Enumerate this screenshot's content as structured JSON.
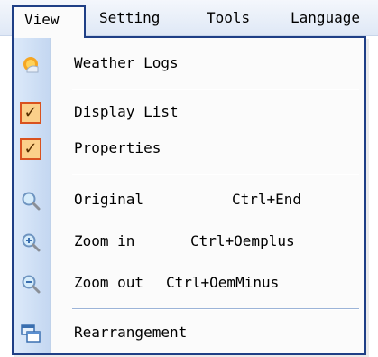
{
  "menubar": {
    "items": [
      "View",
      "Setting",
      "Tools",
      "Language"
    ],
    "active": "View"
  },
  "menu": {
    "weather_logs": "Weather Logs",
    "display_list": "Display List",
    "properties": "Properties",
    "original": "Original",
    "original_shortcut": "Ctrl+End",
    "zoom_in": "Zoom in",
    "zoom_in_shortcut": "Ctrl+Oemplus",
    "zoom_out": "Zoom out",
    "zoom_out_shortcut": "Ctrl+OemMinus",
    "rearrangement": "Rearrangement",
    "display_list_checked": true,
    "properties_checked": true
  },
  "icons": {
    "weather_logs": "weather-sun-icon",
    "display_list": "checkmark-icon",
    "properties": "checkmark-icon",
    "original": "magnifier-icon",
    "zoom_in": "zoom-in-icon",
    "zoom_out": "zoom-out-icon",
    "rearrangement": "rearrange-windows-icon"
  },
  "colors": {
    "menu_border": "#1f3f86",
    "gutter": "#c4d7f1",
    "check_fill": "#fbd08a",
    "check_border": "#d9521f"
  }
}
